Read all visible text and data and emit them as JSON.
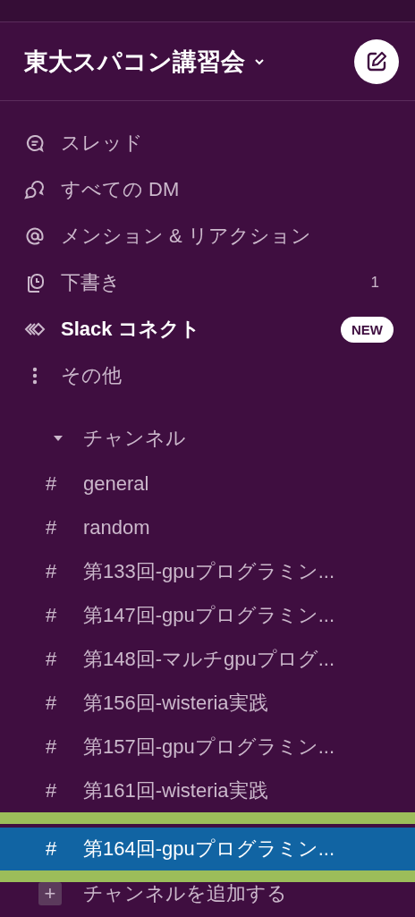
{
  "workspace": {
    "name": "東大スパコン講習会"
  },
  "nav": [
    {
      "kind": "threads",
      "label": "スレッド",
      "bold": false
    },
    {
      "kind": "dms",
      "label": "すべての DM",
      "bold": false
    },
    {
      "kind": "mentions",
      "label": "メンション & リアクション",
      "bold": false
    },
    {
      "kind": "drafts",
      "label": "下書き",
      "bold": false,
      "count": "1"
    },
    {
      "kind": "connect",
      "label": "Slack コネクト",
      "bold": true,
      "badge": "NEW"
    },
    {
      "kind": "more",
      "label": "その他",
      "bold": false
    }
  ],
  "channels": {
    "title": "チャンネル",
    "expanded": true,
    "items": [
      {
        "symbol": "#",
        "name": "general",
        "selected": false,
        "outlined": false
      },
      {
        "symbol": "#",
        "name": "random",
        "selected": false,
        "outlined": false
      },
      {
        "symbol": "#",
        "name": "第133回-gpuプログラミン...",
        "selected": false,
        "outlined": false
      },
      {
        "symbol": "#",
        "name": "第147回-gpuプログラミン...",
        "selected": false,
        "outlined": false
      },
      {
        "symbol": "#",
        "name": "第148回-マルチgpuプログ...",
        "selected": false,
        "outlined": false
      },
      {
        "symbol": "#",
        "name": "第156回-wisteria実践",
        "selected": false,
        "outlined": false
      },
      {
        "symbol": "#",
        "name": "第157回-gpuプログラミン...",
        "selected": false,
        "outlined": false
      },
      {
        "symbol": "#",
        "name": "第161回-wisteria実践",
        "selected": false,
        "outlined": false
      },
      {
        "symbol": "#",
        "name": "第164回-gpuプログラミン...",
        "selected": true,
        "outlined": true
      }
    ],
    "add": {
      "symbol": "+",
      "label": "チャンネルを追加する"
    }
  }
}
